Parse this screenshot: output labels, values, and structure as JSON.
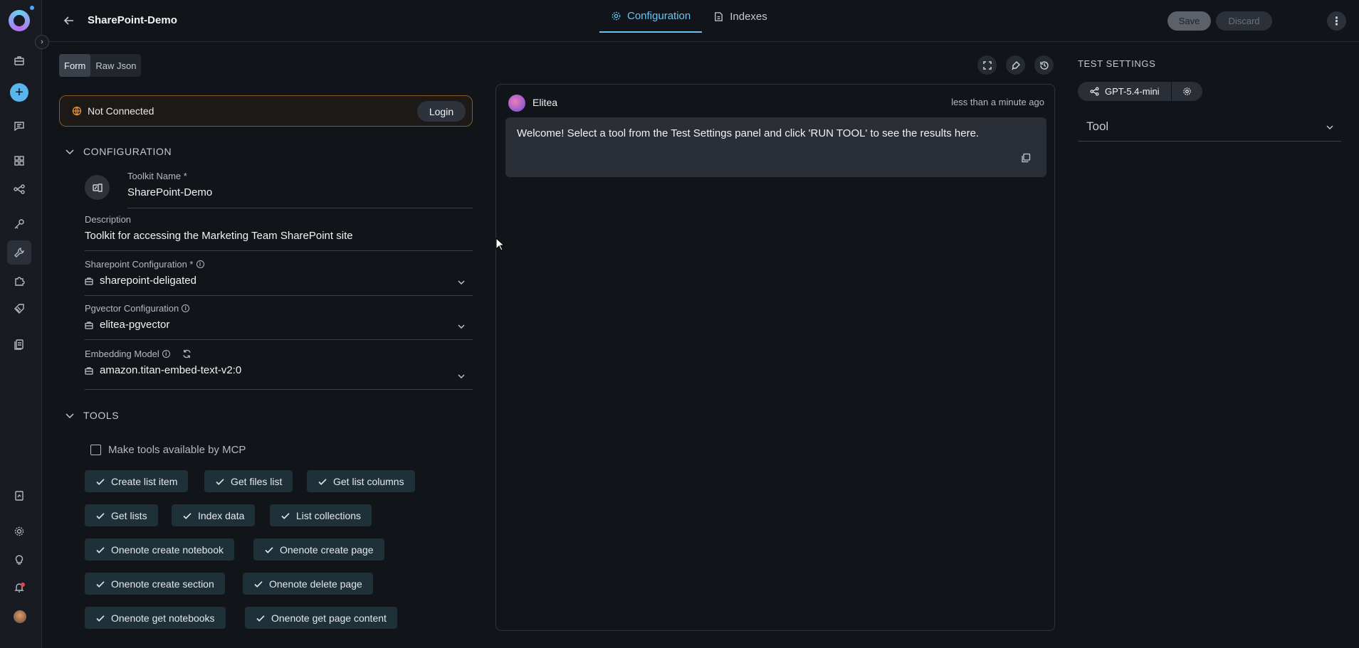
{
  "header": {
    "title": "SharePoint-Demo",
    "tabs": [
      {
        "label": "Configuration",
        "active": true
      },
      {
        "label": "Indexes",
        "active": false
      }
    ],
    "save_label": "Save",
    "discard_label": "Discard"
  },
  "mode_toggle": {
    "form_label": "Form",
    "raw_label": "Raw Json",
    "active": "Form"
  },
  "connection": {
    "status": "Not Connected",
    "login_label": "Login"
  },
  "configuration": {
    "section_title": "CONFIGURATION",
    "toolkit_name_label": "Toolkit Name *",
    "toolkit_name_value": "SharePoint-Demo",
    "description_label": "Description",
    "description_value": "Toolkit for accessing the Marketing Team SharePoint site",
    "sharepoint_config_label": "Sharepoint Configuration *",
    "sharepoint_config_value": "sharepoint-deligated",
    "pgvector_label": "Pgvector Configuration",
    "pgvector_value": "elitea-pgvector",
    "embedding_label": "Embedding Model",
    "embedding_value": "amazon.titan-embed-text-v2:0"
  },
  "tools": {
    "section_title": "TOOLS",
    "mcp_label": "Make tools available by MCP",
    "mcp_checked": false,
    "items": [
      "Create list item",
      "Get files list",
      "Get list columns",
      "Get lists",
      "Index data",
      "List collections",
      "Onenote create notebook",
      "Onenote create page",
      "Onenote create section",
      "Onenote delete page",
      "Onenote get notebooks",
      "Onenote get page content"
    ]
  },
  "chat": {
    "sender": "Elitea",
    "time": "less than a minute ago",
    "message": "Welcome! Select a tool from the Test Settings panel and click 'RUN TOOL' to see the results here."
  },
  "test_settings": {
    "title": "TEST SETTINGS",
    "model": "GPT-5.4-mini",
    "tool_label": "Tool"
  },
  "colors": {
    "accent": "#6cc4f2",
    "warning_border": "#8a5a2c",
    "chip_bg": "#1e3038",
    "background": "#111418"
  }
}
